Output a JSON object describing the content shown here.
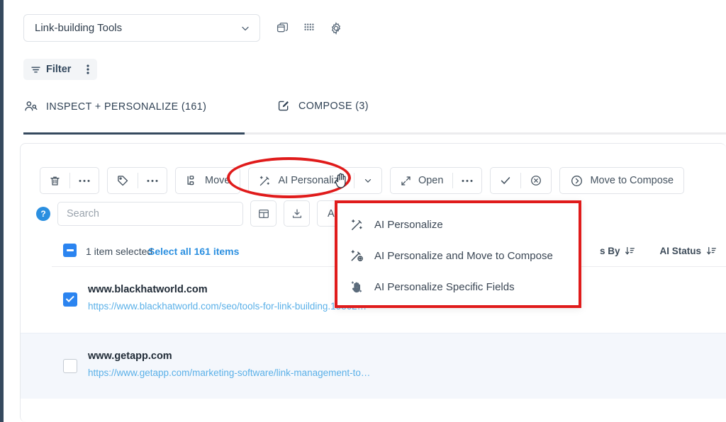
{
  "topbar": {
    "workspace_value": "Link-building Tools",
    "chevron_icon": "chevron-down-icon",
    "duplicate_icon": "duplicate-icon",
    "apps_grid_icon": "apps-grid-icon",
    "settings_icon": "gear-icon"
  },
  "filterbar": {
    "filter_label": "Filter",
    "filter_icon": "filter-icon",
    "kebab_icon": "more-vertical-icon"
  },
  "tabs": [
    {
      "label": "INSPECT + PERSONALIZE (161)",
      "icon": "people-icon",
      "active": true
    },
    {
      "label": "COMPOSE (3)",
      "icon": "compose-pencil-icon",
      "active": false
    }
  ],
  "toolbar": {
    "delete_icon": "trash-icon",
    "delete_more_icon": "more-horizontal-icon",
    "tag_icon": "tag-icon",
    "tag_more_icon": "more-horizontal-icon",
    "move_label": "Move",
    "move_icon": "move-hierarchy-icon",
    "ai_personalize_label": "AI Personalize",
    "ai_personalize_icon": "magic-wand-icon",
    "ai_personalize_caret_icon": "chevron-down-icon",
    "open_label": "Open",
    "open_icon": "expand-arrows-icon",
    "open_more_icon": "more-horizontal-icon",
    "approve_icon": "check-icon",
    "reject_icon": "circle-x-icon",
    "move_to_compose_label": "Move to Compose",
    "move_to_compose_icon": "circle-arrow-right-icon"
  },
  "searchrow": {
    "help_icon": "help-circle-icon",
    "help_label": "?",
    "search_placeholder": "Search",
    "search_value": "",
    "columns_icon": "table-layout-icon",
    "download_icon": "download-icon",
    "partial_button_label": "A"
  },
  "selection": {
    "checkbox_state": "indeterminate",
    "count_text": "1 item selected",
    "select_all_label": "Select all 161 items",
    "columns": [
      {
        "label": "s By",
        "sort_icon": "sort-desc-icon"
      },
      {
        "label": "AI Status",
        "sort_icon": "sort-desc-icon"
      }
    ]
  },
  "rows": [
    {
      "checked": true,
      "domain": "www.blackhatworld.com",
      "url": "https://www.blackhatworld.com/seo/tools-for-link-building.15862…"
    },
    {
      "checked": false,
      "domain": "www.getapp.com",
      "url": "https://www.getapp.com/marketing-software/link-management-to…"
    }
  ],
  "dropdown_menu": {
    "items": [
      {
        "label": "AI Personalize",
        "icon": "magic-wand-icon"
      },
      {
        "label": "AI Personalize and Move to Compose",
        "icon": "magic-wand-plus-icon"
      },
      {
        "label": "AI Personalize Specific Fields",
        "icon": "magic-hand-icon"
      }
    ]
  },
  "annotation": {
    "ellipse_color": "#e01b1b",
    "menu_border_color": "#e01b1b",
    "cursor_icon": "hand-cursor-icon"
  },
  "colors": {
    "rail": "#35495e",
    "accent_blue": "#2b84f0",
    "link_blue": "#5ab0e8",
    "alt_row": "#f4f7fc",
    "tab_underline": "#35495e"
  }
}
